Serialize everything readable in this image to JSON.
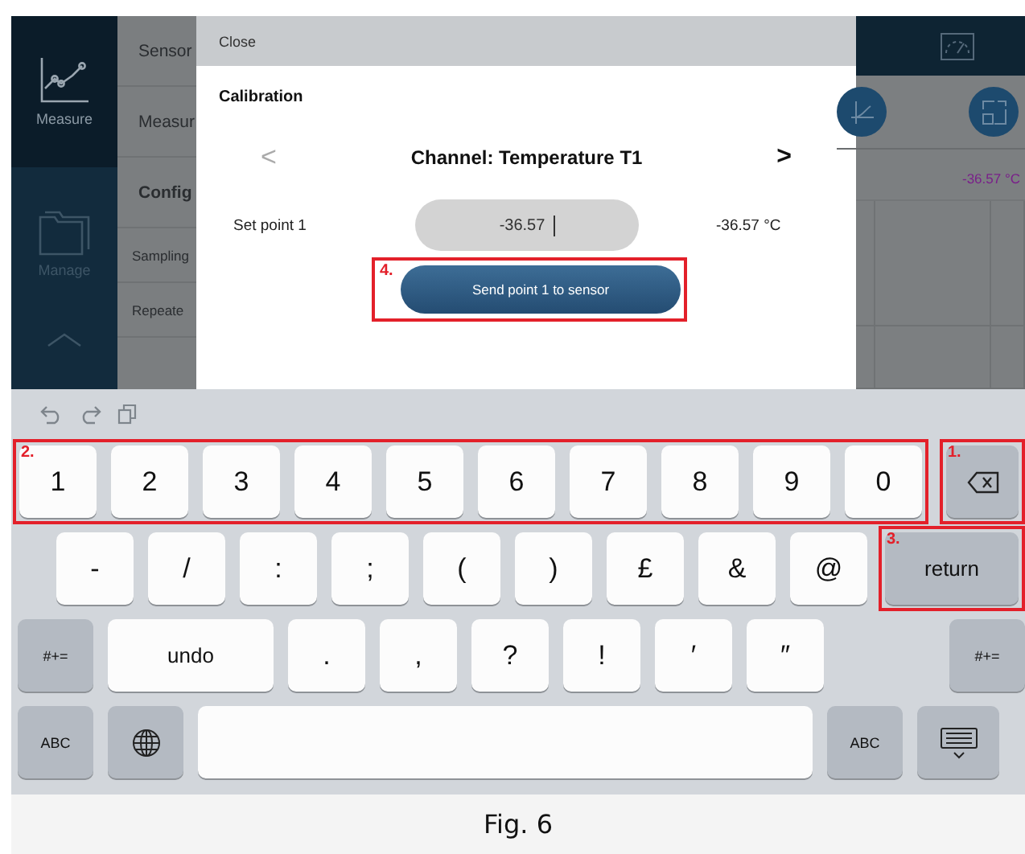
{
  "nav": [
    {
      "label": "Measure",
      "selected": true
    },
    {
      "label": "Manage",
      "selected": false
    }
  ],
  "menu": [
    {
      "label": "Sensor",
      "kind": "item"
    },
    {
      "label": "Measur",
      "kind": "item"
    },
    {
      "label": "Config",
      "kind": "heading"
    },
    {
      "label": "Sampling",
      "kind": "sub"
    },
    {
      "label": "Repeate",
      "kind": "sub"
    }
  ],
  "dialog": {
    "close": "Close",
    "title": "Calibration",
    "prev": "<",
    "channel": "Channel: Temperature T1",
    "next": ">",
    "set_point_label": "Set point 1",
    "set_point_value": "-36.57",
    "set_point_reading": "-36.57 °C",
    "send_button": {
      "label": "Send point 1 to sensor",
      "annotation": "4."
    }
  },
  "live_reading": "-36.57 °C",
  "keyboard": {
    "rows": [
      [
        {
          "annotation": "2.",
          "keys": [
            {
              "kind": "char",
              "label": "1"
            },
            {
              "kind": "char",
              "label": "2"
            },
            {
              "kind": "char",
              "label": "3"
            },
            {
              "kind": "char",
              "label": "4"
            },
            {
              "kind": "char",
              "label": "5"
            },
            {
              "kind": "char",
              "label": "6"
            },
            {
              "kind": "char",
              "label": "7"
            },
            {
              "kind": "char",
              "label": "8"
            },
            {
              "kind": "char",
              "label": "9"
            },
            {
              "kind": "char",
              "label": "0"
            }
          ]
        },
        {
          "annotation": "1.",
          "keys": [
            {
              "kind": "delete"
            }
          ]
        }
      ],
      [
        {
          "keys": [
            {
              "kind": "char",
              "label": "-"
            },
            {
              "kind": "char",
              "label": "/"
            },
            {
              "kind": "char",
              "label": ":"
            },
            {
              "kind": "char",
              "label": ";"
            },
            {
              "kind": "char",
              "label": "("
            },
            {
              "kind": "char",
              "label": ")"
            },
            {
              "kind": "char",
              "label": "£"
            },
            {
              "kind": "char",
              "label": "&"
            },
            {
              "kind": "char",
              "label": "@"
            }
          ]
        },
        {
          "annotation": "3.",
          "keys": [
            {
              "kind": "return",
              "label": "return"
            }
          ]
        }
      ],
      [
        {
          "keys": [
            {
              "kind": "function",
              "label": "#+="
            },
            {
              "kind": "wide",
              "label": "undo"
            },
            {
              "kind": "char",
              "label": "."
            },
            {
              "kind": "char",
              "label": ","
            },
            {
              "kind": "char",
              "label": "?"
            },
            {
              "kind": "char",
              "label": "!"
            },
            {
              "kind": "char",
              "label": "′"
            },
            {
              "kind": "char",
              "label": "″"
            }
          ]
        },
        {
          "keys": [
            {
              "kind": "function",
              "label": "#+="
            }
          ]
        }
      ],
      [
        {
          "keys": [
            {
              "kind": "function",
              "label": "ABC"
            },
            {
              "kind": "globe"
            },
            {
              "kind": "space"
            },
            {
              "kind": "function",
              "label": "ABC"
            },
            {
              "kind": "hide"
            }
          ]
        }
      ]
    ]
  },
  "caption": "Fig. 6"
}
